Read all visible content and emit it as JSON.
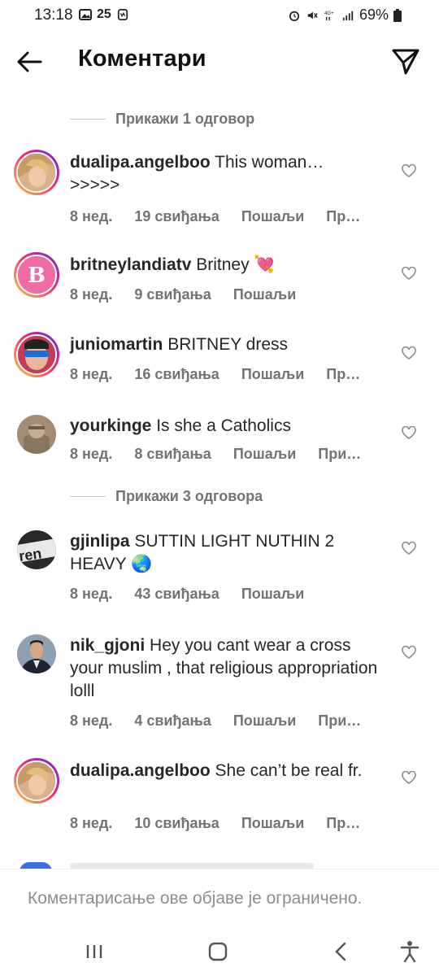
{
  "status_bar": {
    "time": "13:18",
    "notification_count": "25",
    "battery": "69%"
  },
  "header": {
    "title": "Коментари"
  },
  "comments": [
    {
      "type": "replies",
      "label": "Прикажи 1 одговор"
    },
    {
      "type": "comment",
      "username": "dualipa.angelboo",
      "text": "This woman…\n>>>>>",
      "time": "8 нед.",
      "likes": "19 свиђања",
      "send": "Пошаљи",
      "more": "Пр…",
      "avatar": "dualipa-avatar"
    },
    {
      "type": "comment",
      "username": "britneylandiatv",
      "text": "Britney 💘",
      "time": "8 нед.",
      "likes": "9 свиђања",
      "send": "Пошаљи",
      "more": "",
      "avatar": "britney-logo-avatar"
    },
    {
      "type": "comment",
      "username": "juniomartin",
      "text": "BRITNEY dress",
      "time": "8 нед.",
      "likes": "16 свиђања",
      "send": "Пошаљи",
      "more": "Пр…",
      "avatar": "junio-avatar"
    },
    {
      "type": "comment",
      "username": "yourkinge",
      "text": "Is she a Catholics",
      "time": "8 нед.",
      "likes": "8 свиђања",
      "send": "Пошаљи",
      "more": "При…",
      "avatar": "yourkinge-avatar"
    },
    {
      "type": "replies",
      "label": "Прикажи 3 одговора"
    },
    {
      "type": "comment",
      "username": "gjinlipa",
      "text": "SUTTIN LIGHT NUTHIN 2 HEAVY 🌏",
      "time": "8 нед.",
      "likes": "43 свиђања",
      "send": "Пошаљи",
      "more": "",
      "avatar": "gjinlipa-avatar"
    },
    {
      "type": "comment",
      "username": "nik_gjoni",
      "text": "Hey you cant wear a cross your muslim , that religious appropriation lolll",
      "time": "8 нед.",
      "likes": "4 свиђања",
      "send": "Пошаљи",
      "more": "При…",
      "avatar": "nik-avatar"
    },
    {
      "type": "comment",
      "username": "dualipa.angelboo",
      "text": "She can’t be real fr.",
      "time": "8 нед.",
      "likes": "10 свиђања",
      "send": "Пошаљи",
      "more": "Пр…",
      "avatar": "dualipa-avatar"
    }
  ],
  "footer": {
    "restricted_text": "Коментарисање ове објаве је ограничено."
  },
  "colors": {
    "primary_text": "#262626",
    "secondary_text": "#737373",
    "story_ring_start": "#f9ce34",
    "story_ring_mid": "#ee2a7b",
    "story_ring_end": "#6228d7",
    "britney_logo_bg": "#f06aa6"
  }
}
